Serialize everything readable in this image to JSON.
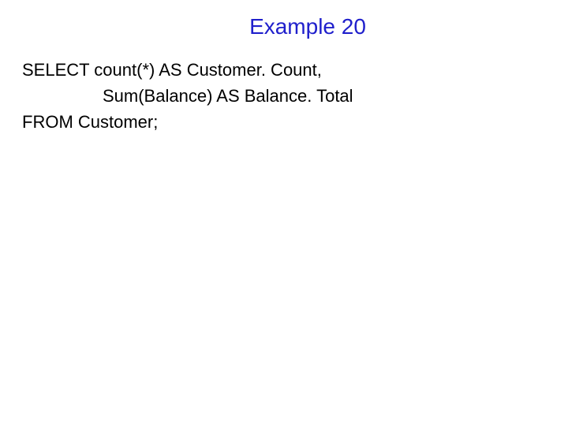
{
  "title": "Example 20",
  "sql": {
    "line1": "SELECT count(*) AS Customer. Count,",
    "line2": "Sum(Balance) AS Balance. Total",
    "line3": "FROM Customer;"
  }
}
